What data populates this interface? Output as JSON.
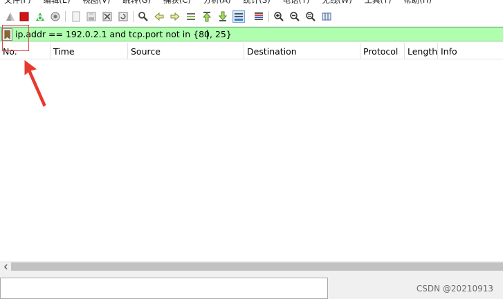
{
  "menu": {
    "items": [
      "文件(F)",
      "编辑(E)",
      "视图(V)",
      "跳转(G)",
      "捕获(C)",
      "分析(A)",
      "统计(S)",
      "电话(Y)",
      "无线(W)",
      "工具(T)",
      "帮助(H)"
    ]
  },
  "toolbar": {
    "buttons": [
      "shark-fin-start-icon",
      "stop-capture-icon",
      "restart-capture-icon",
      "capture-options-icon",
      "open-file-icon",
      "save-file-icon",
      "close-file-icon",
      "reload-file-icon",
      "find-packet-icon",
      "go-back-icon",
      "go-forward-icon",
      "go-to-packet-icon",
      "first-packet-icon",
      "last-packet-icon",
      "autoscroll-icon",
      "colorize-icon",
      "zoom-in-icon",
      "zoom-out-icon",
      "zoom-normal-icon",
      "resize-columns-icon"
    ]
  },
  "filter": {
    "value": "ip.addr == 192.0.2.1 and tcp.port not in {80, 25}",
    "background": "#afffaf"
  },
  "packet_list": {
    "columns": [
      "No.",
      "Time",
      "Source",
      "Destination",
      "Protocol",
      "Length",
      "Info"
    ]
  },
  "annotation": {
    "color": "#e04848"
  },
  "watermark": "CSDN @20210913"
}
